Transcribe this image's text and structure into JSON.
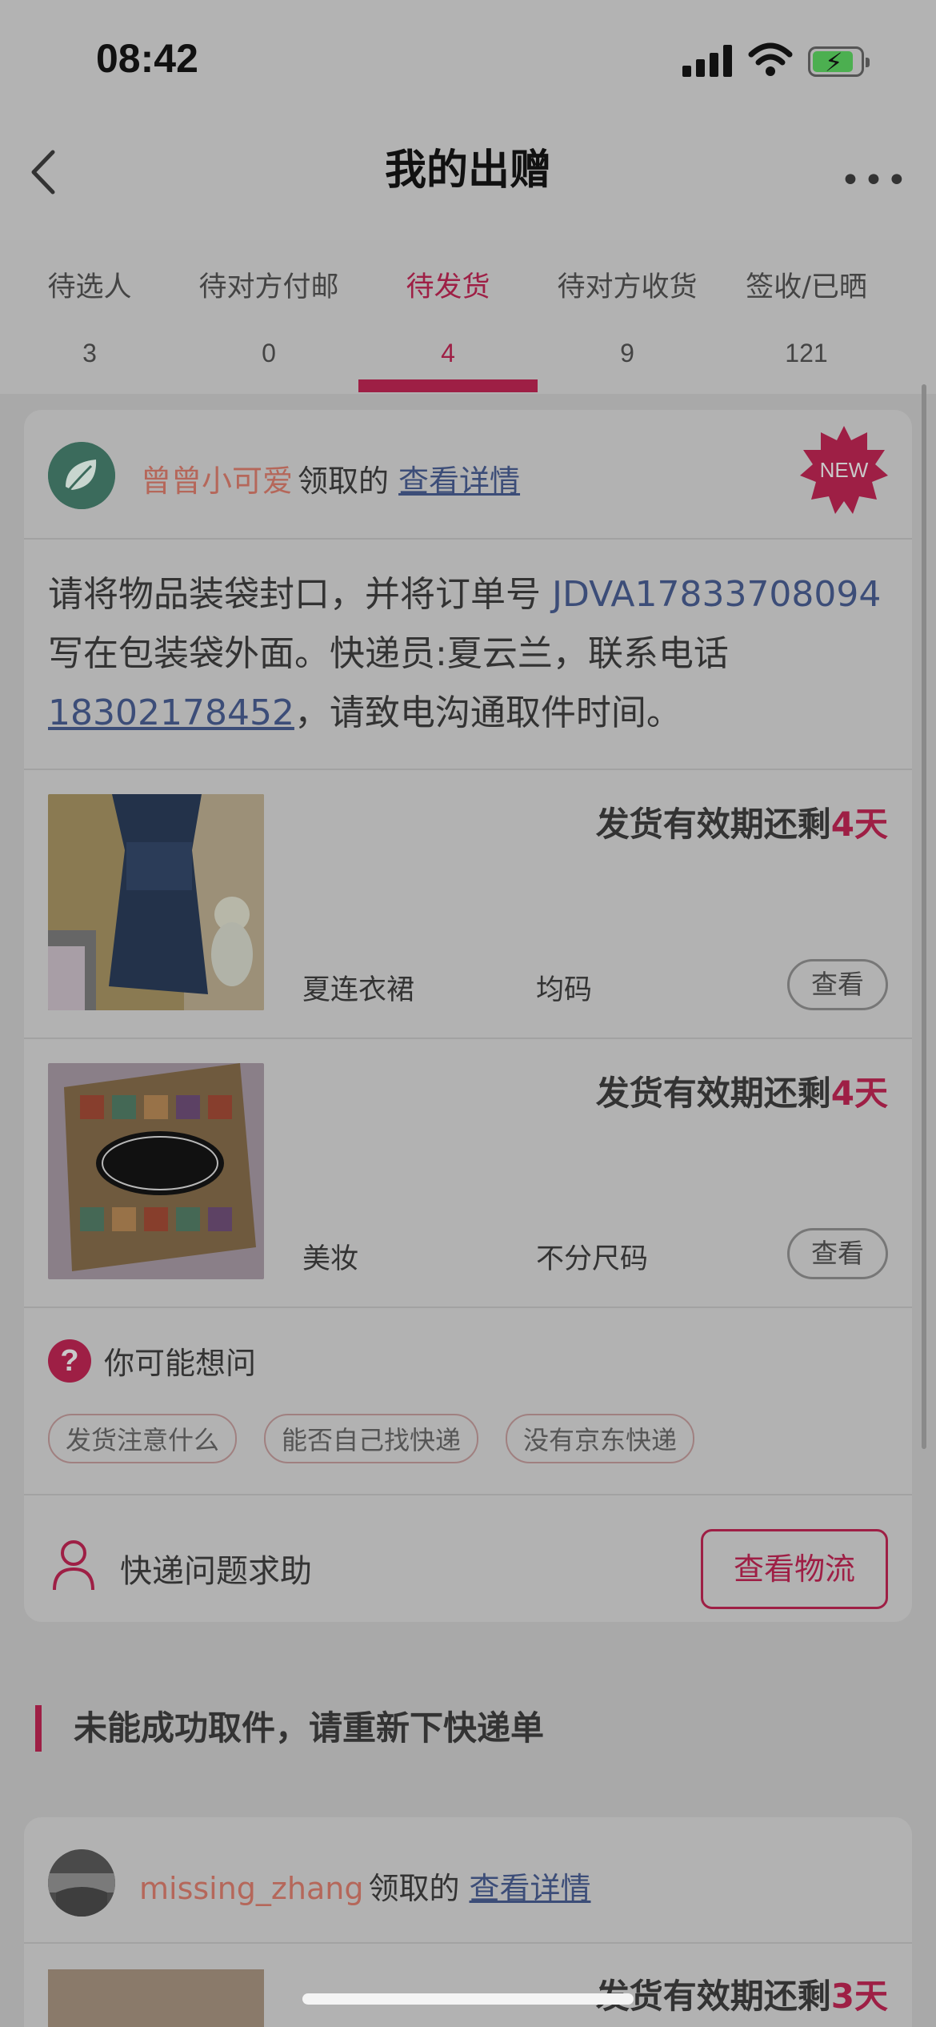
{
  "status_bar": {
    "time": "08:42"
  },
  "nav": {
    "title": "我的出赠"
  },
  "tabs": [
    {
      "label": "待选人",
      "count": "3"
    },
    {
      "label": "待对方付邮",
      "count": "0"
    },
    {
      "label": "待发货",
      "count": "4"
    },
    {
      "label": "待对方收货",
      "count": "9"
    },
    {
      "label": "签收/已晒",
      "count": "121"
    }
  ],
  "card": {
    "user_name": "曾曾小可爱",
    "received_text": "领取的",
    "detail_link": "查看详情",
    "new_badge": "NEW",
    "instruction": {
      "prefix": "请将物品装袋封口，并将订单号 ",
      "order_number": "JDVA17833708094",
      "middle": " 写在包装袋外面。快递员:夏云兰，联系电话",
      "phone": "18302178452",
      "suffix": "，请致电沟通取件时间。"
    },
    "items": [
      {
        "deadline_prefix": "发货有效期还剩",
        "deadline_days": "4天",
        "name": "夏连衣裙",
        "size": "均码",
        "view_label": "查看"
      },
      {
        "deadline_prefix": "发货有效期还剩",
        "deadline_days": "4天",
        "name": "美妆",
        "size": "不分尺码",
        "view_label": "查看"
      }
    ],
    "faq": {
      "title": "你可能想问",
      "chips": [
        "发货注意什么",
        "能否自己找快递",
        "没有京东快递"
      ]
    },
    "help": {
      "label": "快递问题求助",
      "button": "查看物流"
    }
  },
  "section": {
    "title": "未能成功取件，请重新下快递单"
  },
  "card2": {
    "user_name": "missing_zhang",
    "received_text": "领取的",
    "detail_link": "查看详情",
    "deadline_prefix": "发货有效期还剩",
    "deadline_days": "3天"
  },
  "colors": {
    "accent": "#9e1f45",
    "link": "#3c4d78",
    "username": "#b5675a"
  },
  "icons": [
    "back-arrow-icon",
    "more-icon",
    "leaf-avatar-icon",
    "new-badge-icon",
    "question-icon",
    "person-icon"
  ]
}
